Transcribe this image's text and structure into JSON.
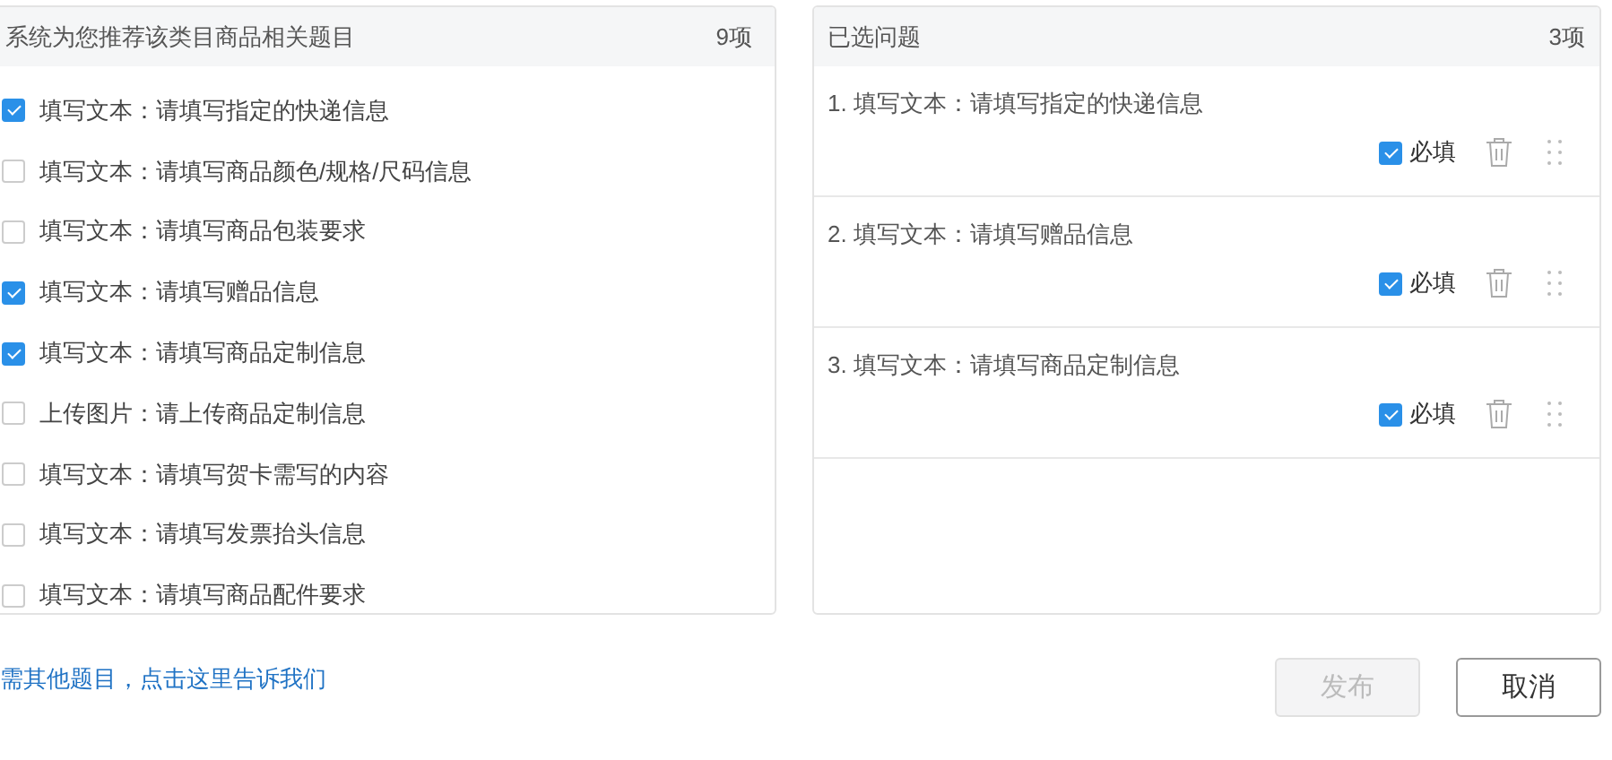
{
  "recommended": {
    "title": "系统为您推荐该类目商品相关题目",
    "count": "9项",
    "items": [
      {
        "label": "填写文本：请填写指定的快递信息",
        "checked": true
      },
      {
        "label": "填写文本：请填写商品颜色/规格/尺码信息",
        "checked": false
      },
      {
        "label": "填写文本：请填写商品包装要求",
        "checked": false
      },
      {
        "label": "填写文本：请填写赠品信息",
        "checked": true
      },
      {
        "label": "填写文本：请填写商品定制信息",
        "checked": true
      },
      {
        "label": "上传图片：请上传商品定制信息",
        "checked": false
      },
      {
        "label": "填写文本：请填写贺卡需写的内容",
        "checked": false
      },
      {
        "label": "填写文本：请填写发票抬头信息",
        "checked": false
      },
      {
        "label": "填写文本：请填写商品配件要求",
        "checked": false
      }
    ]
  },
  "selected_questions": {
    "title": "已选问题",
    "count": "3项",
    "items": [
      {
        "label": "1. 填写文本：请填写指定的快递信息",
        "required": true,
        "required_label": "必填"
      },
      {
        "label": "2. 填写文本：请填写赠品信息",
        "required": true,
        "required_label": "必填"
      },
      {
        "label": "3. 填写文本：请填写商品定制信息",
        "required": true,
        "required_label": "必填"
      }
    ]
  },
  "feedback_link": "需其他题目，点击这里告诉我们",
  "buttons": [
    {
      "label": "发布",
      "disabled": true
    },
    {
      "label": "取消",
      "disabled": false
    }
  ]
}
